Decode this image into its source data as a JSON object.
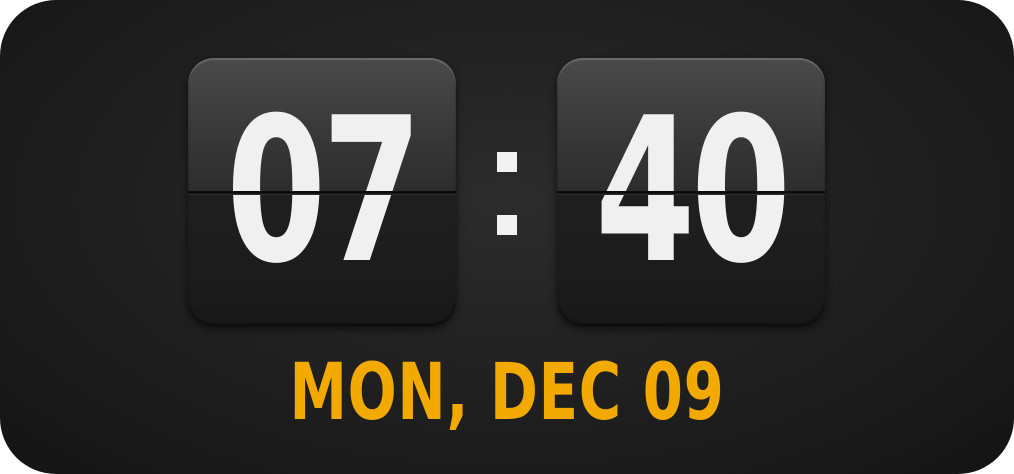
{
  "clock": {
    "hours": "07",
    "separator": ":",
    "minutes": "40",
    "date": "MON, DEC 09"
  },
  "colors": {
    "background": "#1e1e1e",
    "card": "#2d2d2d",
    "digits": "#f0f0f0",
    "date_accent": "#f2a900"
  }
}
